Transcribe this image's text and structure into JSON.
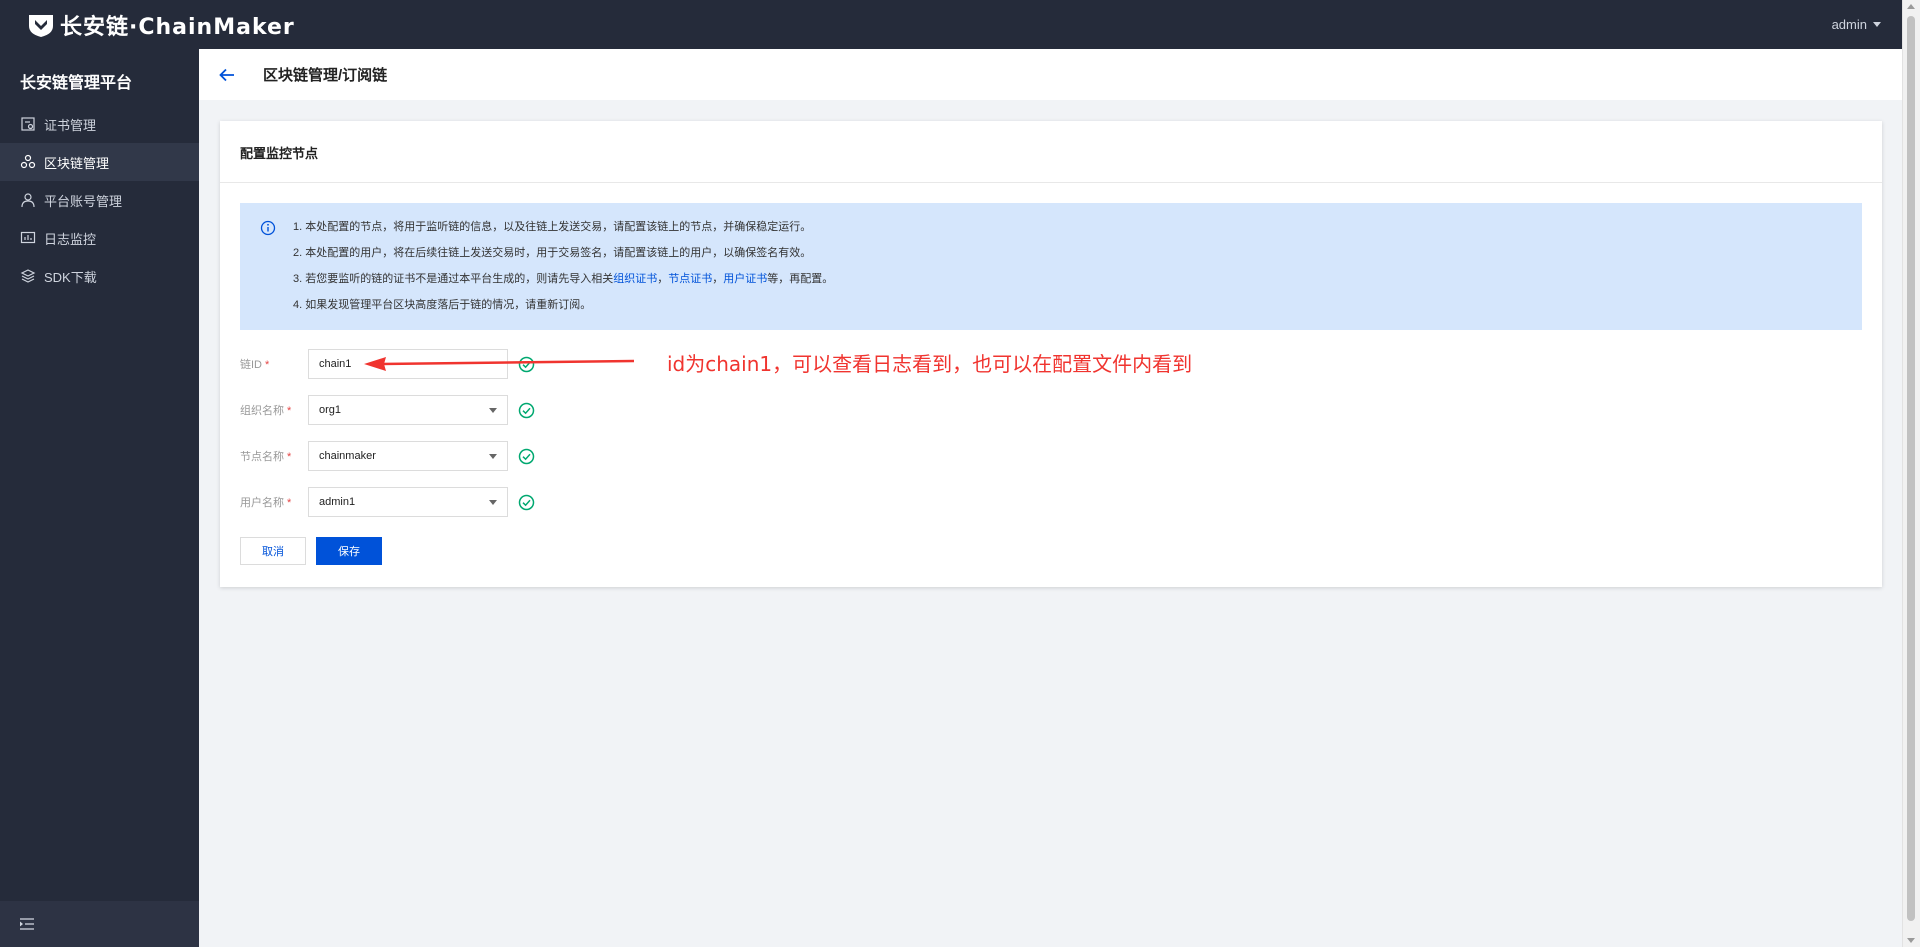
{
  "app": {
    "logo_text": "长安链·ChainMaker",
    "user": "admin"
  },
  "sidebar": {
    "title": "长安链管理平台",
    "items": [
      {
        "label": "证书管理",
        "icon": "certificate-icon",
        "active": false
      },
      {
        "label": "区块链管理",
        "icon": "blockchain-icon",
        "active": true
      },
      {
        "label": "平台账号管理",
        "icon": "user-icon",
        "active": false
      },
      {
        "label": "日志监控",
        "icon": "monitor-icon",
        "active": false
      },
      {
        "label": "SDK下载",
        "icon": "layers-icon",
        "active": false
      }
    ]
  },
  "header": {
    "breadcrumb": "区块链管理/订阅链"
  },
  "card": {
    "title": "配置监控节点",
    "notice": {
      "line1": "1. 本处配置的节点，将用于监听链的信息，以及往链上发送交易，请配置该链上的节点，并确保稳定运行。",
      "line2": "2. 本处配置的用户，将在后续往链上发送交易时，用于交易签名，请配置该链上的用户，以确保签名有效。",
      "line3_prefix": "3. 若您要监听的链的证书不是通过本平台生成的，则请先导入相关",
      "line3_link1": "组织证书",
      "line3_sep1": "，",
      "line3_link2": "节点证书",
      "line3_sep2": "，",
      "line3_link3": "用户证书",
      "line3_suffix": "等，再配置。",
      "line4": "4. 如果发现管理平台区块高度落后于链的情况，请重新订阅。"
    },
    "form": {
      "chain_id": {
        "label": "链ID",
        "value": "chain1"
      },
      "org": {
        "label": "组织名称",
        "value": "org1"
      },
      "node": {
        "label": "节点名称",
        "value": "chainmaker"
      },
      "user": {
        "label": "用户名称",
        "value": "admin1"
      },
      "required_mark": "*"
    },
    "buttons": {
      "cancel": "取消",
      "save": "保存"
    }
  },
  "annotation": {
    "text": "id为chain1，可以查看日志看到，也可以在配置文件内看到",
    "color": "#f0342f"
  },
  "colors": {
    "primary": "#0052d9",
    "sidebar_bg": "#252b3a",
    "notice_bg": "#d5e6fc",
    "success": "#00a870"
  }
}
